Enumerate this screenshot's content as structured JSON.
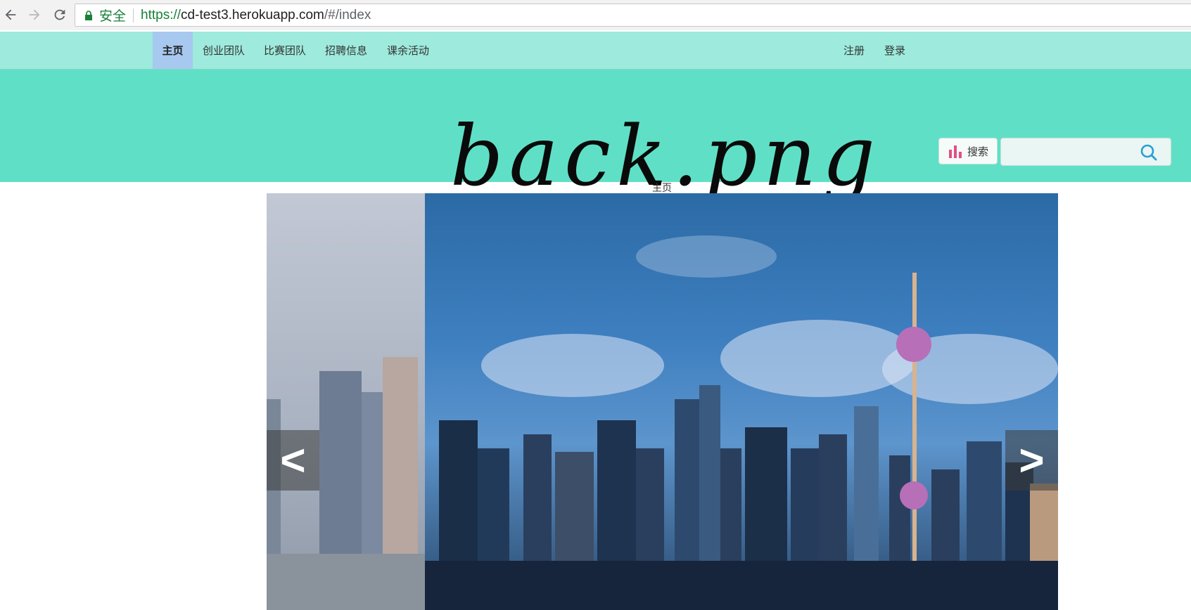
{
  "browser": {
    "secure_label": "安全",
    "url_protocol": "https://",
    "url_host": "cd-test3.herokuapp.com",
    "url_path": "/#/index"
  },
  "nav": {
    "items": [
      {
        "label": "主页",
        "active": true
      },
      {
        "label": "创业团队"
      },
      {
        "label": "比赛团队"
      },
      {
        "label": "招聘信息"
      },
      {
        "label": "课余活动"
      }
    ],
    "register_label": "注册",
    "login_label": "登录"
  },
  "banner": {
    "text": "back.png",
    "search_button_label": "搜索",
    "search_placeholder": ""
  },
  "breadcrumb": "主页",
  "carousel": {
    "prev_label": "<",
    "next_label": ">"
  },
  "colors": {
    "nav_bg": "#9eeadc",
    "banner_bg": "#5fe0c6",
    "active_nav_bg": "#a7c8ef",
    "secure_green": "#188038"
  }
}
